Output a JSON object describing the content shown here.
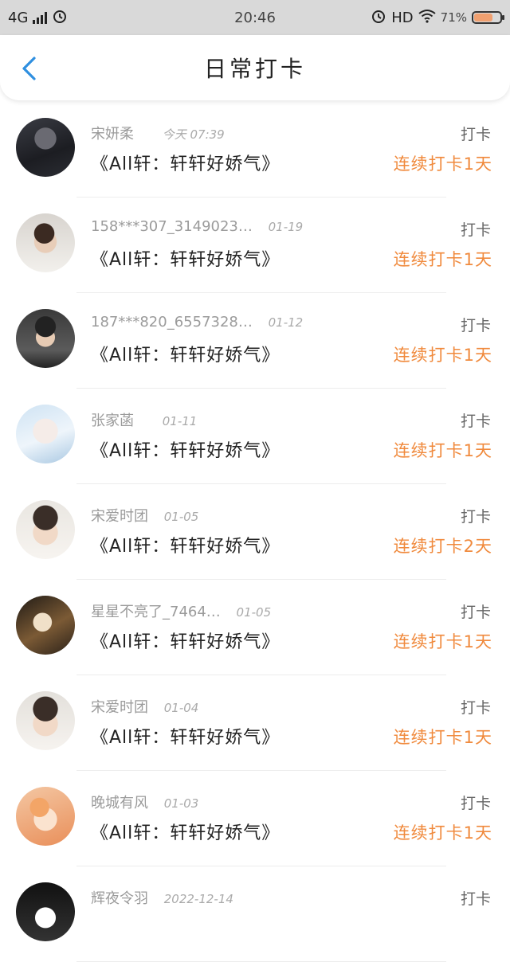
{
  "status_bar": {
    "network": "4G",
    "time": "20:46",
    "hd": "HD",
    "battery_percent": "71%",
    "battery_level": 0.71,
    "icons": [
      "signal-icon",
      "alarm-icon",
      "alarm-icon",
      "wifi-icon",
      "battery-icon"
    ]
  },
  "nav": {
    "title": "日常打卡",
    "back_icon": "chevron-left-icon",
    "accent": "#2f8fe0"
  },
  "items": [
    {
      "name": "宋妍柔",
      "date": "今天 07:39",
      "content": "《All轩：轩轩好娇气》",
      "action": "打卡",
      "streak": "连续打卡1天"
    },
    {
      "name": "158***307_3149023…",
      "date": "01-19",
      "content": "《All轩：轩轩好娇气》",
      "action": "打卡",
      "streak": "连续打卡1天"
    },
    {
      "name": "187***820_6557328…",
      "date": "01-12",
      "content": "《All轩：轩轩好娇气》",
      "action": "打卡",
      "streak": "连续打卡1天"
    },
    {
      "name": "张家菡",
      "date": "01-11",
      "content": "《All轩：轩轩好娇气》",
      "action": "打卡",
      "streak": "连续打卡1天"
    },
    {
      "name": "宋爱时团",
      "date": "01-05",
      "content": "《All轩：轩轩好娇气》",
      "action": "打卡",
      "streak": "连续打卡2天"
    },
    {
      "name": "星星不亮了_7464…",
      "date": "01-05",
      "content": "《All轩：轩轩好娇气》",
      "action": "打卡",
      "streak": "连续打卡1天"
    },
    {
      "name": "宋爱时团",
      "date": "01-04",
      "content": "《All轩：轩轩好娇气》",
      "action": "打卡",
      "streak": "连续打卡1天"
    },
    {
      "name": "晚城有风",
      "date": "01-03",
      "content": "《All轩：轩轩好娇气》",
      "action": "打卡",
      "streak": "连续打卡1天"
    },
    {
      "name": "辉夜令羽",
      "date": "2022-12-14",
      "content": "",
      "action": "打卡",
      "streak": ""
    }
  ],
  "colors": {
    "streak": "#f08a3d",
    "status_bar_bg": "#d9d9d9",
    "battery_fill": "#f0a070"
  }
}
